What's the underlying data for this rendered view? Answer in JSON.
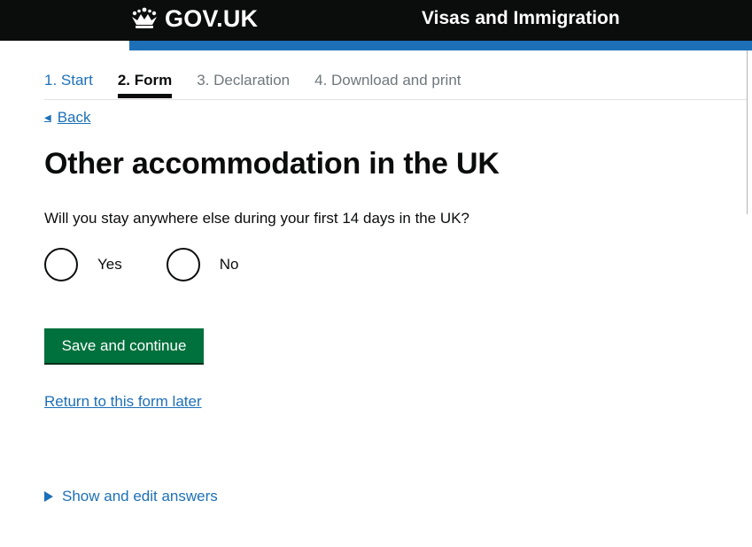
{
  "header": {
    "logo_text": "GOV.UK",
    "service_name": "Visas and Immigration",
    "colors": {
      "background": "#0b0c0c",
      "accent_bar": "#1d70b8"
    }
  },
  "steps": [
    {
      "label": "1. Start",
      "state": "done"
    },
    {
      "label": "2. Form",
      "state": "current"
    },
    {
      "label": "3. Declaration",
      "state": "future"
    },
    {
      "label": "4. Download and print",
      "state": "future"
    }
  ],
  "back_link": {
    "label": "Back",
    "icon": "triangle-left-icon"
  },
  "page_title": "Other accommodation in the UK",
  "question": "Will you stay anywhere else during your first 14 days in the UK?",
  "radios": [
    {
      "label": "Yes",
      "checked": false
    },
    {
      "label": "No",
      "checked": false
    }
  ],
  "primary_button": {
    "label": "Save and continue",
    "color": "#00703c"
  },
  "return_link": "Return to this form later",
  "details_toggle": {
    "label": "Show and edit answers",
    "icon": "triangle-right-icon"
  }
}
